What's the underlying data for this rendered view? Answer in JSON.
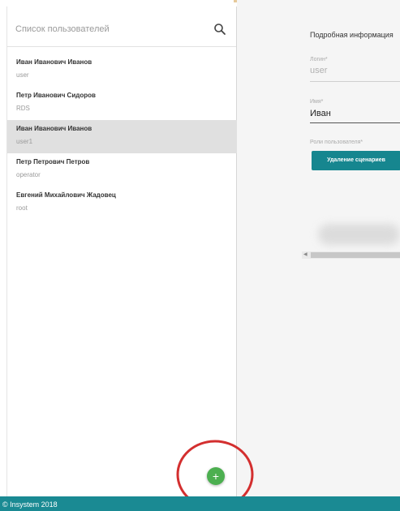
{
  "sidebar": {
    "title": "Список пользователей",
    "users": [
      {
        "name": "Иван Иванович Иванов",
        "login": "user"
      },
      {
        "name": "Петр Иванович Сидоров",
        "login": "RDS"
      },
      {
        "name": "Иван Иванович Иванов",
        "login": "user1"
      },
      {
        "name": "Петр Петрович Петров",
        "login": "operator"
      },
      {
        "name": "Евгений Михайлович Жадовец",
        "login": "root"
      }
    ],
    "selected_index": 2,
    "add_label": "+"
  },
  "details": {
    "title": "Подробная информация",
    "login_label": "Логин*",
    "login_value": "user",
    "name_label": "Имя*",
    "name_value": "Иван",
    "roles_label": "Роли пользователя*",
    "role_button": "Удаление сценариев"
  },
  "footer": {
    "copyright": "© Insystem 2018"
  },
  "colors": {
    "accent": "#16868f",
    "footer": "#1a8a93",
    "add_button": "#4caf50",
    "annotation": "#d32f2f"
  }
}
